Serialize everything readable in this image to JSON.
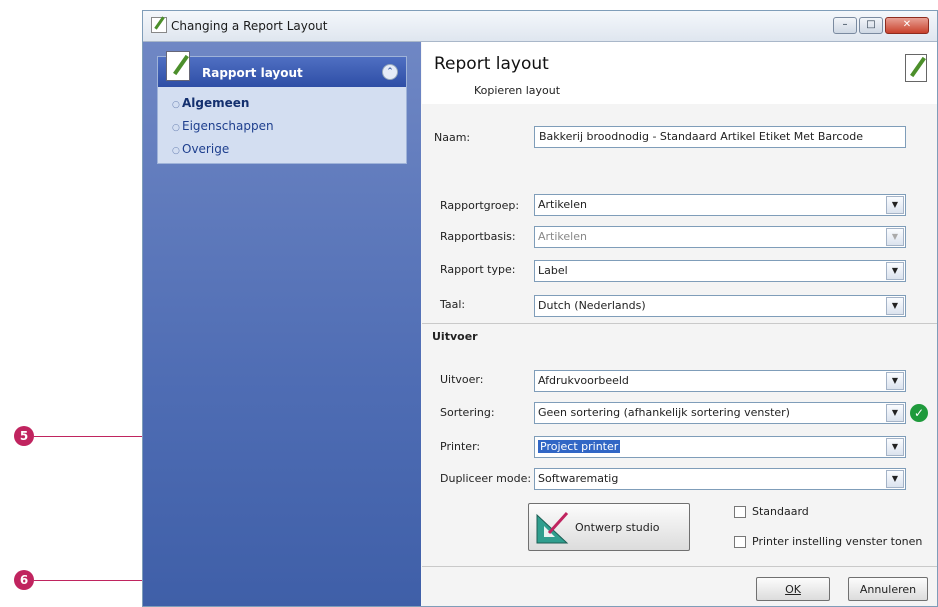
{
  "window": {
    "title": "Changing a Report Layout",
    "controls": [
      "minimize",
      "maximize",
      "close"
    ]
  },
  "sidebar": {
    "header": "Rapport layout",
    "items": [
      {
        "label": "Algemeen",
        "active": true
      },
      {
        "label": "Eigenschappen",
        "active": false
      },
      {
        "label": "Overige",
        "active": false
      }
    ]
  },
  "header": {
    "title": "Report layout",
    "subtitle": "Kopieren layout"
  },
  "form": {
    "naam_label": "Naam:",
    "naam_value": "Bakkerij broodnodig - Standaard Artikel Etiket Met Barcode",
    "rapportgroep_label": "Rapportgroep:",
    "rapportgroep_value": "Artikelen",
    "rapportbasis_label": "Rapportbasis:",
    "rapportbasis_value": "Artikelen",
    "rapporttype_label": "Rapport type:",
    "rapporttype_value": "Label",
    "taal_label": "Taal:",
    "taal_value": "Dutch (Nederlands)",
    "section_uitvoer": "Uitvoer",
    "uitvoer_label": "Uitvoer:",
    "uitvoer_value": "Afdrukvoorbeeld",
    "sortering_label": "Sortering:",
    "sortering_value": "Geen sortering (afhankelijk sortering venster)",
    "printer_label": "Printer:",
    "printer_value": "Project printer",
    "dupliceer_label": "Dupliceer mode:",
    "dupliceer_value": "Softwarematig"
  },
  "buttons": {
    "ontwerp": "Ontwerp studio",
    "ok": "OK",
    "annuleren": "Annuleren"
  },
  "checkboxes": {
    "standaard": {
      "label": "Standaard",
      "checked": false
    },
    "printer_instelling": {
      "label": "Printer instelling venster tonen",
      "checked": false
    }
  },
  "callouts": [
    "5",
    "6"
  ],
  "colors": {
    "accent": "#c0245f",
    "sidebar": "#4f6db4",
    "selection": "#3166c5",
    "ok_check": "#1f9a3c"
  }
}
